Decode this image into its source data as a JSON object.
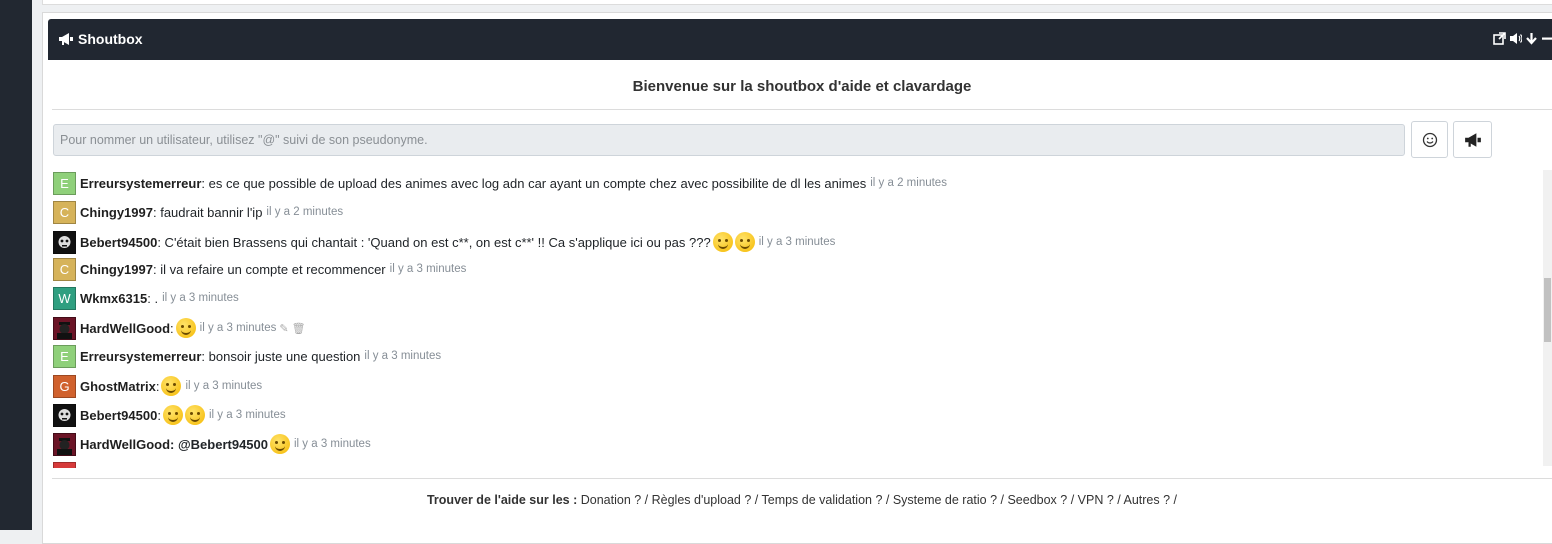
{
  "header": {
    "title": "Shoutbox"
  },
  "welcome": "Bienvenue sur la shoutbox d'aide et clavardage",
  "input": {
    "placeholder": "Pour nommer un utilisateur, utilisez \"@\" suivi de son pseudonyme."
  },
  "messages": [
    {
      "avatar_letter": "E",
      "avatar_color": "#8fd07a",
      "user": "Erreursystemerreur",
      "text": ": es ce que possible de upload des animes avec log adn car ayant un compte chez avec possibilite de dl les animes",
      "time": "il y a 2 minutes"
    },
    {
      "avatar_letter": "C",
      "avatar_color": "#d6b35a",
      "user": "Chingy1997",
      "text": ": faudrait bannir l'ip",
      "time": "il y a 2 minutes"
    },
    {
      "avatar_letter": "",
      "user": "Bebert94500",
      "text": ": C'était bien Brassens qui chantait : 'Quand on est c**, on est c**' !! Ca s'applique ici ou pas ???",
      "time": "il y a 3 minutes"
    },
    {
      "avatar_letter": "C",
      "avatar_color": "#d6b35a",
      "user": "Chingy1997",
      "text": ": il va refaire un compte et recommencer",
      "time": "il y a 3 minutes"
    },
    {
      "avatar_letter": "W",
      "avatar_color": "#2f9f80",
      "user": "Wkmx6315",
      "text": ": .",
      "time": "il y a 3 minutes"
    },
    {
      "avatar_letter": "",
      "user": "HardWellGood",
      "text": ":",
      "time": "il y a 3 minutes"
    },
    {
      "avatar_letter": "E",
      "avatar_color": "#8fd07a",
      "user": "Erreursystemerreur",
      "text": ": bonsoir juste une question",
      "time": "il y a 3 minutes"
    },
    {
      "avatar_letter": "G",
      "avatar_color": "#d0612d",
      "user": "GhostMatrix",
      "text": ":",
      "time": "il y a 3 minutes"
    },
    {
      "avatar_letter": "",
      "user": "Bebert94500",
      "text": ":",
      "time": "il y a 3 minutes"
    },
    {
      "avatar_letter": "",
      "user": "HardWellGood",
      "text": ": @Bebert94500",
      "time": "il y a 3 minutes"
    }
  ],
  "footer": {
    "label": "Trouver de l'aide sur les :",
    "links": "Donation ? / Règles d'upload ? / Temps de validation ? / Systeme de ratio ? / Seedbox ? / VPN ? / Autres ? /"
  }
}
